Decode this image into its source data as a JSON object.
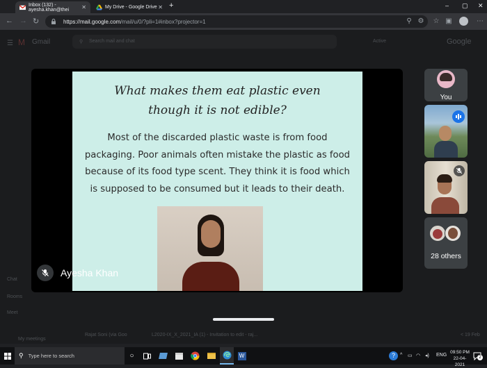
{
  "browser": {
    "tabs": [
      {
        "title": "Inbox (132) - ayesha.khan@thei",
        "active": true
      },
      {
        "title": "My Drive - Google Drive",
        "active": false
      }
    ],
    "new_tab": "+",
    "url_main": "https://mail.google.com",
    "url_rest": "/mail/u/0/?pli=1#inbox?projector=1",
    "window_controls": {
      "minimize": "–",
      "maximize": "▢",
      "close": "✕"
    }
  },
  "gmail_bg": {
    "app_name": "Gmail",
    "search_placeholder": "Search mail and chat",
    "status": "Active",
    "brand": "Google",
    "side_labels": [
      "Chat",
      "Rooms",
      "Meet"
    ],
    "my_meetings": "My meetings",
    "row_sender": "Rajat Soni (via Goo",
    "row_subject": "L2020-IX_X_2021_IA (1) - Invitation to edit - raj...",
    "row_date": "< 19 Feb"
  },
  "meet": {
    "slide_title_line1": "What makes them eat plastic even",
    "slide_title_line2": "though it is not edible?",
    "slide_body": "Most of the discarded plastic waste is from food packaging. Poor animals often mistake the plastic as food because of its food type scent. They think it is food which is supposed to be consumed but it leads to their death.",
    "speaker_name": "Ayesha Khan",
    "self_label": "You",
    "others_label": "28 others"
  },
  "taskbar": {
    "search_placeholder": "Type here to search",
    "lang": "ENG",
    "time": "09:50 PM",
    "date": "22-04-2021",
    "notif_count": "2"
  },
  "colors": {
    "slide_bg": "#cdeee8",
    "meet_blue": "#1a73e8",
    "chrome_dark": "#202124"
  }
}
